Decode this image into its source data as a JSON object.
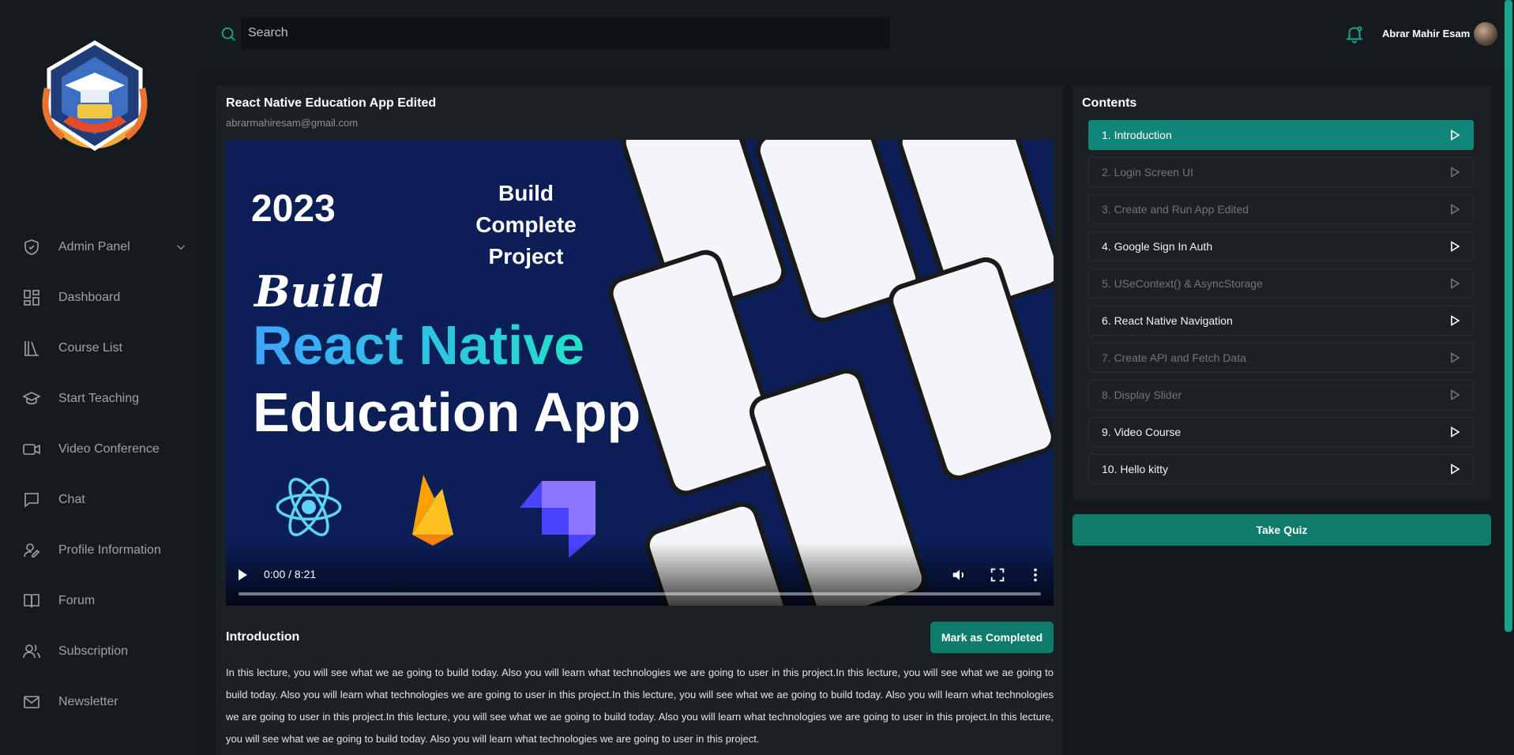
{
  "nav": {
    "items": [
      {
        "label": "Admin Panel",
        "icon": "shield-check-icon"
      },
      {
        "label": "Dashboard",
        "icon": "grid-icon"
      },
      {
        "label": "Course List",
        "icon": "books-icon"
      },
      {
        "label": "Start Teaching",
        "icon": "graduation-cap-icon"
      },
      {
        "label": "Video Conference",
        "icon": "video-camera-icon"
      },
      {
        "label": "Chat",
        "icon": "chat-bubble-icon"
      },
      {
        "label": "Profile Information",
        "icon": "user-edit-icon"
      },
      {
        "label": "Forum",
        "icon": "book-open-icon"
      },
      {
        "label": "Subscription",
        "icon": "users-icon"
      },
      {
        "label": "Newsletter",
        "icon": "mail-icon"
      }
    ]
  },
  "header": {
    "search_placeholder": "Search",
    "user_name": "Abrar Mahir Esam"
  },
  "course": {
    "title": "React Native Education App Edited",
    "author_email": "abrarmahiresam@gmail.com",
    "video": {
      "thumbnail_year": "2023",
      "thumbnail_tagline": "Build Complete Project",
      "thumbnail_build": "Build",
      "thumbnail_headline_1": "React Native",
      "thumbnail_headline_2": "Education App",
      "time_display": "0:00 / 8:21",
      "progress": 0
    },
    "lesson_title": "Introduction",
    "mark_button": "Mark as Completed",
    "description": "In this lecture, you will see what we ae going to build today. Also you will learn what technologies we are going to user in this project.In this lecture, you will see what we ae going to build today. Also you will learn what technologies we are going to user in this project.In this lecture, you will see what we ae going to build today. Also you will learn what technologies we are going to user in this project.In this lecture, you will see what we ae going to build today. Also you will learn what technologies we are going to user in this project.In this lecture, you will see what we ae going to build today. Also you will learn what technologies we are going to user in this project."
  },
  "contents": {
    "title": "Contents",
    "lessons": [
      {
        "label": "1. Introduction",
        "state": "active"
      },
      {
        "label": "2. Login Screen UI",
        "state": "dim"
      },
      {
        "label": "3. Create and Run App Edited",
        "state": "dim"
      },
      {
        "label": "4. Google Sign In Auth",
        "state": "lit"
      },
      {
        "label": "5. USeContext() & AsyncStorage",
        "state": "dim"
      },
      {
        "label": "6. React Native Navigation",
        "state": "lit"
      },
      {
        "label": "7. Create API and Fetch Data",
        "state": "dim"
      },
      {
        "label": "8. Display Slider",
        "state": "dim"
      },
      {
        "label": "9. Video Course",
        "state": "lit"
      },
      {
        "label": "10. Hello kitty",
        "state": "lit"
      }
    ],
    "quiz_button": "Take Quiz"
  },
  "colors": {
    "accent": "#11877a",
    "background": "#13181c",
    "panel": "#1b2024"
  }
}
